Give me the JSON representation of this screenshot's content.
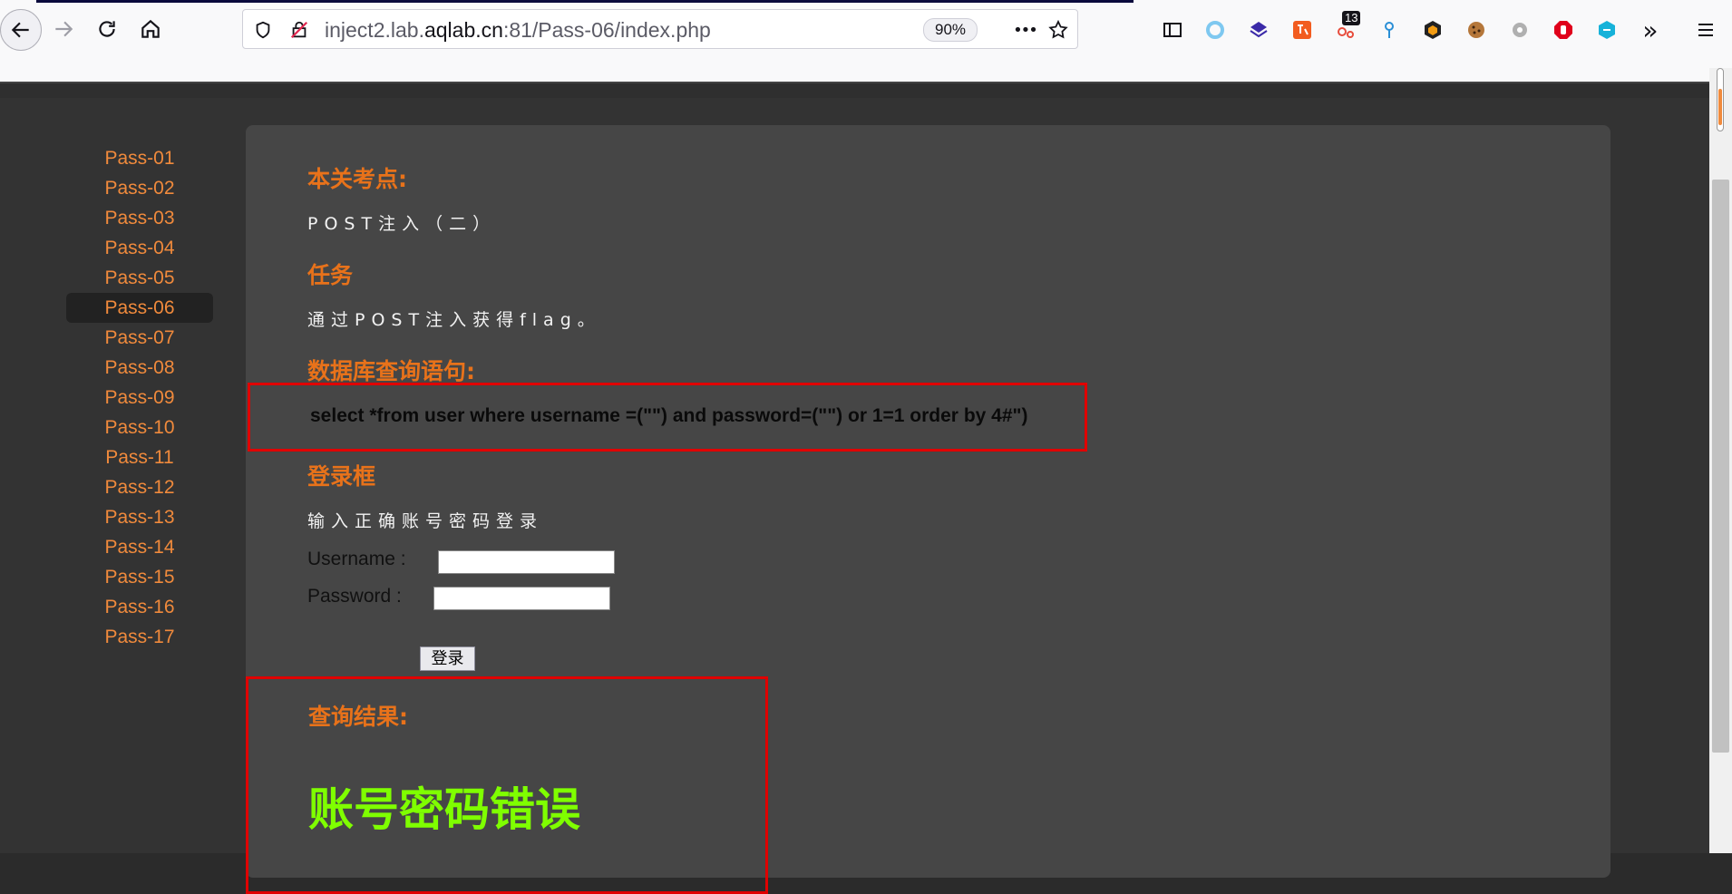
{
  "browser": {
    "url_prefix": "inject2.lab.",
    "url_domain": "aqlab.cn",
    "url_suffix": ":81/Pass-06/index.php",
    "zoom": "90%",
    "more_label": "•••",
    "ext_badge_count": "13",
    "overflow_label": "»"
  },
  "sidebar": {
    "items": [
      {
        "label": "Pass-01"
      },
      {
        "label": "Pass-02"
      },
      {
        "label": "Pass-03"
      },
      {
        "label": "Pass-04"
      },
      {
        "label": "Pass-05"
      },
      {
        "label": "Pass-06"
      },
      {
        "label": "Pass-07"
      },
      {
        "label": "Pass-08"
      },
      {
        "label": "Pass-09"
      },
      {
        "label": "Pass-10"
      },
      {
        "label": "Pass-11"
      },
      {
        "label": "Pass-12"
      },
      {
        "label": "Pass-13"
      },
      {
        "label": "Pass-14"
      },
      {
        "label": "Pass-15"
      },
      {
        "label": "Pass-16"
      },
      {
        "label": "Pass-17"
      }
    ],
    "active": "Pass-06"
  },
  "content": {
    "section1_title": "本关考点:",
    "section1_text": "POST注入（二）",
    "section2_title": "任务",
    "section2_text": "通过POST注入获得flag。",
    "section3_title": "数据库查询语句:",
    "query": "select *from user where username =(\"\") and password=(\"\") or 1=1 order by 4#\")",
    "section4_title": "登录框",
    "section4_text": "输入正确账号密码登录",
    "username_label": "Username :",
    "password_label": "Password :",
    "username_value": "",
    "password_value": "",
    "login_button": "登录",
    "result_title": "查询结果:",
    "result_text": "账号密码错误"
  },
  "colors": {
    "accent_orange": "#e8721a",
    "sidebar_link": "#f08a3c",
    "result_green": "#7fff00",
    "highlight_red": "#e00000"
  }
}
